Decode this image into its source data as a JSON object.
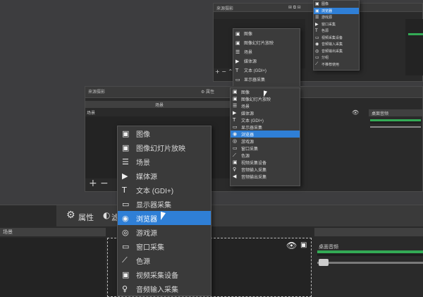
{
  "small_window": {
    "scenes_title": "来源摄影",
    "icon_row": "⊞ ⧉ ⊟",
    "menu_items": [
      "图像",
      "图像幻灯片放映",
      "场景",
      "媒体源",
      "文本 (GDI+)",
      "显示器采集",
      "浏览器",
      "游戏源",
      "窗口采集",
      "色源",
      "视频采集设备",
      "音频输入采集",
      "音频输出采集"
    ],
    "menu_group": "分组",
    "menu_deprecated": "不推荐使用",
    "right_menu_items": [
      "图像",
      "浏览器",
      "游戏源",
      "窗口采集",
      "色源",
      "视频采集设备",
      "音频输入采集",
      "音频输出采集",
      "分组",
      "不推荐使用"
    ]
  },
  "medium_window": {
    "title": "来源摄影",
    "props_label": "⚙ 属性",
    "scenes_header": "场景",
    "scene_item": "场景",
    "mixer_header": "桌面音频",
    "menu_items": [
      "图像",
      "图像幻灯片放映",
      "场景",
      "媒体源",
      "文本 (GDI+)",
      "显示器采集",
      "浏览器",
      "游戏源",
      "窗口采集",
      "色源",
      "视频采集设备",
      "音频输入采集",
      "音频输出采集"
    ],
    "menu_group": "分组",
    "menu_deprecated": "不推荐使用"
  },
  "large_window": {
    "props_label": "属性",
    "filters_label": "滤",
    "scenes_header_label": "场景",
    "mixer_header": "桌面音频",
    "toolbar_plus": "+",
    "toolbar_minus": "−",
    "menu_items": [
      "图像",
      "图像幻灯片放映",
      "场景",
      "媒体源",
      "文本 (GDI+)",
      "显示器采集",
      "浏览器",
      "游戏源",
      "窗口采集",
      "色源",
      "视频采集设备",
      "音频输入采集"
    ],
    "highlighted_index": 6
  },
  "colors": {
    "highlight": "#2f7fd6",
    "meter_green": "#33aa55"
  }
}
